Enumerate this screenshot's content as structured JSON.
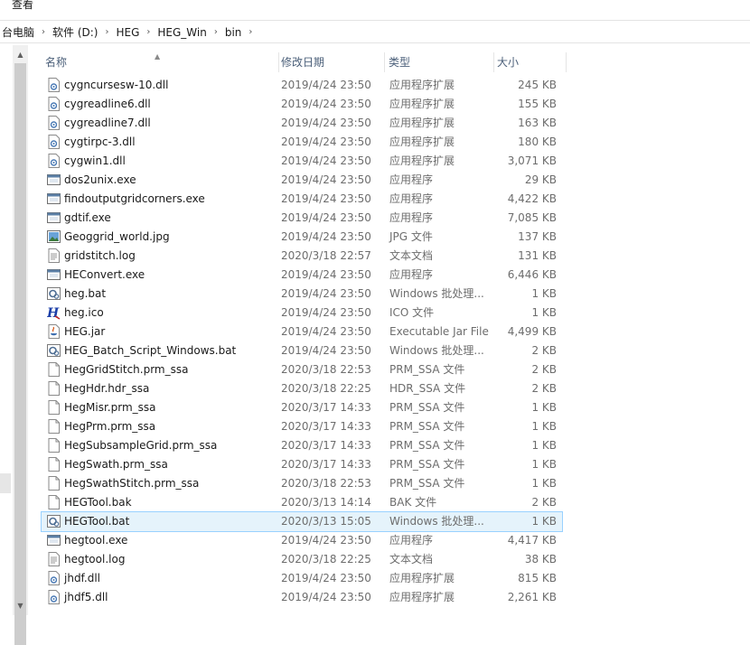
{
  "menu": {
    "view_label": "查看"
  },
  "breadcrumb": [
    "台电脑",
    "软件 (D:)",
    "HEG",
    "HEG_Win",
    "bin"
  ],
  "columns": {
    "name": "名称",
    "date": "修改日期",
    "type": "类型",
    "size": "大小"
  },
  "files": [
    {
      "name": "cygncursesw-10.dll",
      "date": "2019/4/24 23:50",
      "type": "应用程序扩展",
      "size": "245 KB",
      "icon": "dll-icon"
    },
    {
      "name": "cygreadline6.dll",
      "date": "2019/4/24 23:50",
      "type": "应用程序扩展",
      "size": "155 KB",
      "icon": "dll-icon"
    },
    {
      "name": "cygreadline7.dll",
      "date": "2019/4/24 23:50",
      "type": "应用程序扩展",
      "size": "163 KB",
      "icon": "dll-icon"
    },
    {
      "name": "cygtirpc-3.dll",
      "date": "2019/4/24 23:50",
      "type": "应用程序扩展",
      "size": "180 KB",
      "icon": "dll-icon"
    },
    {
      "name": "cygwin1.dll",
      "date": "2019/4/24 23:50",
      "type": "应用程序扩展",
      "size": "3,071 KB",
      "icon": "dll-icon"
    },
    {
      "name": "dos2unix.exe",
      "date": "2019/4/24 23:50",
      "type": "应用程序",
      "size": "29 KB",
      "icon": "exe-icon"
    },
    {
      "name": "findoutputgridcorners.exe",
      "date": "2019/4/24 23:50",
      "type": "应用程序",
      "size": "4,422 KB",
      "icon": "exe-icon"
    },
    {
      "name": "gdtif.exe",
      "date": "2019/4/24 23:50",
      "type": "应用程序",
      "size": "7,085 KB",
      "icon": "exe-icon"
    },
    {
      "name": "Geoggrid_world.jpg",
      "date": "2019/4/24 23:50",
      "type": "JPG 文件",
      "size": "137 KB",
      "icon": "image-icon"
    },
    {
      "name": "gridstitch.log",
      "date": "2020/3/18 22:57",
      "type": "文本文档",
      "size": "131 KB",
      "icon": "text-file-icon"
    },
    {
      "name": "HEConvert.exe",
      "date": "2019/4/24 23:50",
      "type": "应用程序",
      "size": "6,446 KB",
      "icon": "exe-icon"
    },
    {
      "name": "heg.bat",
      "date": "2019/4/24 23:50",
      "type": "Windows 批处理...",
      "size": "1 KB",
      "icon": "bat-icon"
    },
    {
      "name": "heg.ico",
      "date": "2019/4/24 23:50",
      "type": "ICO 文件",
      "size": "1 KB",
      "icon": "heg-ico-icon"
    },
    {
      "name": "HEG.jar",
      "date": "2019/4/24 23:50",
      "type": "Executable Jar File",
      "size": "4,499 KB",
      "icon": "jar-icon"
    },
    {
      "name": "HEG_Batch_Script_Windows.bat",
      "date": "2019/4/24 23:50",
      "type": "Windows 批处理...",
      "size": "2 KB",
      "icon": "bat-icon"
    },
    {
      "name": "HegGridStitch.prm_ssa",
      "date": "2020/3/18 22:53",
      "type": "PRM_SSA 文件",
      "size": "2 KB",
      "icon": "blank-file-icon"
    },
    {
      "name": "HegHdr.hdr_ssa",
      "date": "2020/3/18 22:25",
      "type": "HDR_SSA 文件",
      "size": "2 KB",
      "icon": "blank-file-icon"
    },
    {
      "name": "HegMisr.prm_ssa",
      "date": "2020/3/17 14:33",
      "type": "PRM_SSA 文件",
      "size": "1 KB",
      "icon": "blank-file-icon"
    },
    {
      "name": "HegPrm.prm_ssa",
      "date": "2020/3/17 14:33",
      "type": "PRM_SSA 文件",
      "size": "1 KB",
      "icon": "blank-file-icon"
    },
    {
      "name": "HegSubsampleGrid.prm_ssa",
      "date": "2020/3/17 14:33",
      "type": "PRM_SSA 文件",
      "size": "1 KB",
      "icon": "blank-file-icon"
    },
    {
      "name": "HegSwath.prm_ssa",
      "date": "2020/3/17 14:33",
      "type": "PRM_SSA 文件",
      "size": "1 KB",
      "icon": "blank-file-icon"
    },
    {
      "name": "HegSwathStitch.prm_ssa",
      "date": "2020/3/18 22:53",
      "type": "PRM_SSA 文件",
      "size": "1 KB",
      "icon": "blank-file-icon"
    },
    {
      "name": "HEGTool.bak",
      "date": "2020/3/13 14:14",
      "type": "BAK 文件",
      "size": "2 KB",
      "icon": "blank-file-icon"
    },
    {
      "name": "HEGTool.bat",
      "date": "2020/3/13 15:05",
      "type": "Windows 批处理...",
      "size": "1 KB",
      "icon": "bat-icon",
      "selected": true
    },
    {
      "name": "hegtool.exe",
      "date": "2019/4/24 23:50",
      "type": "应用程序",
      "size": "4,417 KB",
      "icon": "exe-icon"
    },
    {
      "name": "hegtool.log",
      "date": "2020/3/18 22:25",
      "type": "文本文档",
      "size": "38 KB",
      "icon": "text-file-icon"
    },
    {
      "name": "jhdf.dll",
      "date": "2019/4/24 23:50",
      "type": "应用程序扩展",
      "size": "815 KB",
      "icon": "dll-icon"
    },
    {
      "name": "jhdf5.dll",
      "date": "2019/4/24 23:50",
      "type": "应用程序扩展",
      "size": "2,261 KB",
      "icon": "dll-icon"
    }
  ]
}
